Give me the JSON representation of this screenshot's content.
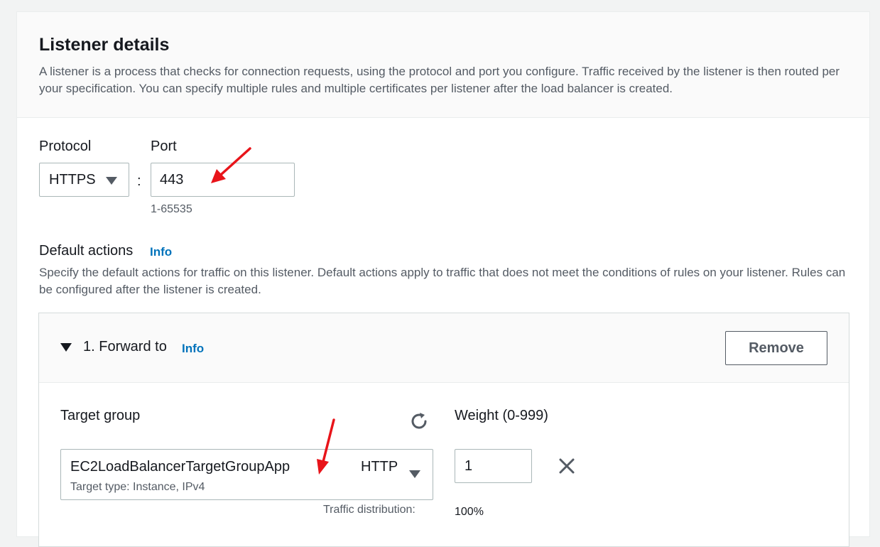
{
  "listener": {
    "title": "Listener details",
    "description": "A listener is a process that checks for connection requests, using the protocol and port you configure. Traffic received by the listener is then routed per your specification. You can specify multiple rules and multiple certificates per listener after the load balancer is created."
  },
  "protocol": {
    "label": "Protocol",
    "value": "HTTPS",
    "separator": ":"
  },
  "port": {
    "label": "Port",
    "value": "443",
    "hint": "1-65535"
  },
  "default_actions": {
    "label": "Default actions",
    "info": "Info",
    "description": "Specify the default actions for traffic on this listener. Default actions apply to traffic that does not meet the conditions of rules on your listener. Rules can be configured after the listener is created."
  },
  "forward": {
    "title": "1. Forward to",
    "info": "Info",
    "remove_label": "Remove",
    "target_group_label": "Target group",
    "target_group_name": "EC2LoadBalancerTargetGroupApp",
    "target_group_protocol": "HTTP",
    "target_type": "Target type: Instance, IPv4",
    "weight_label": "Weight (0-999)",
    "weight_value": "1",
    "traffic_label": "Traffic distribution:",
    "traffic_value": "100%"
  },
  "colors": {
    "link": "#0073bb",
    "annotation": "#e8141a",
    "text": "#16191f",
    "muted": "#545b64"
  },
  "icons": [
    "caret-down-icon",
    "expand-triangle-icon",
    "refresh-icon",
    "close-icon"
  ]
}
